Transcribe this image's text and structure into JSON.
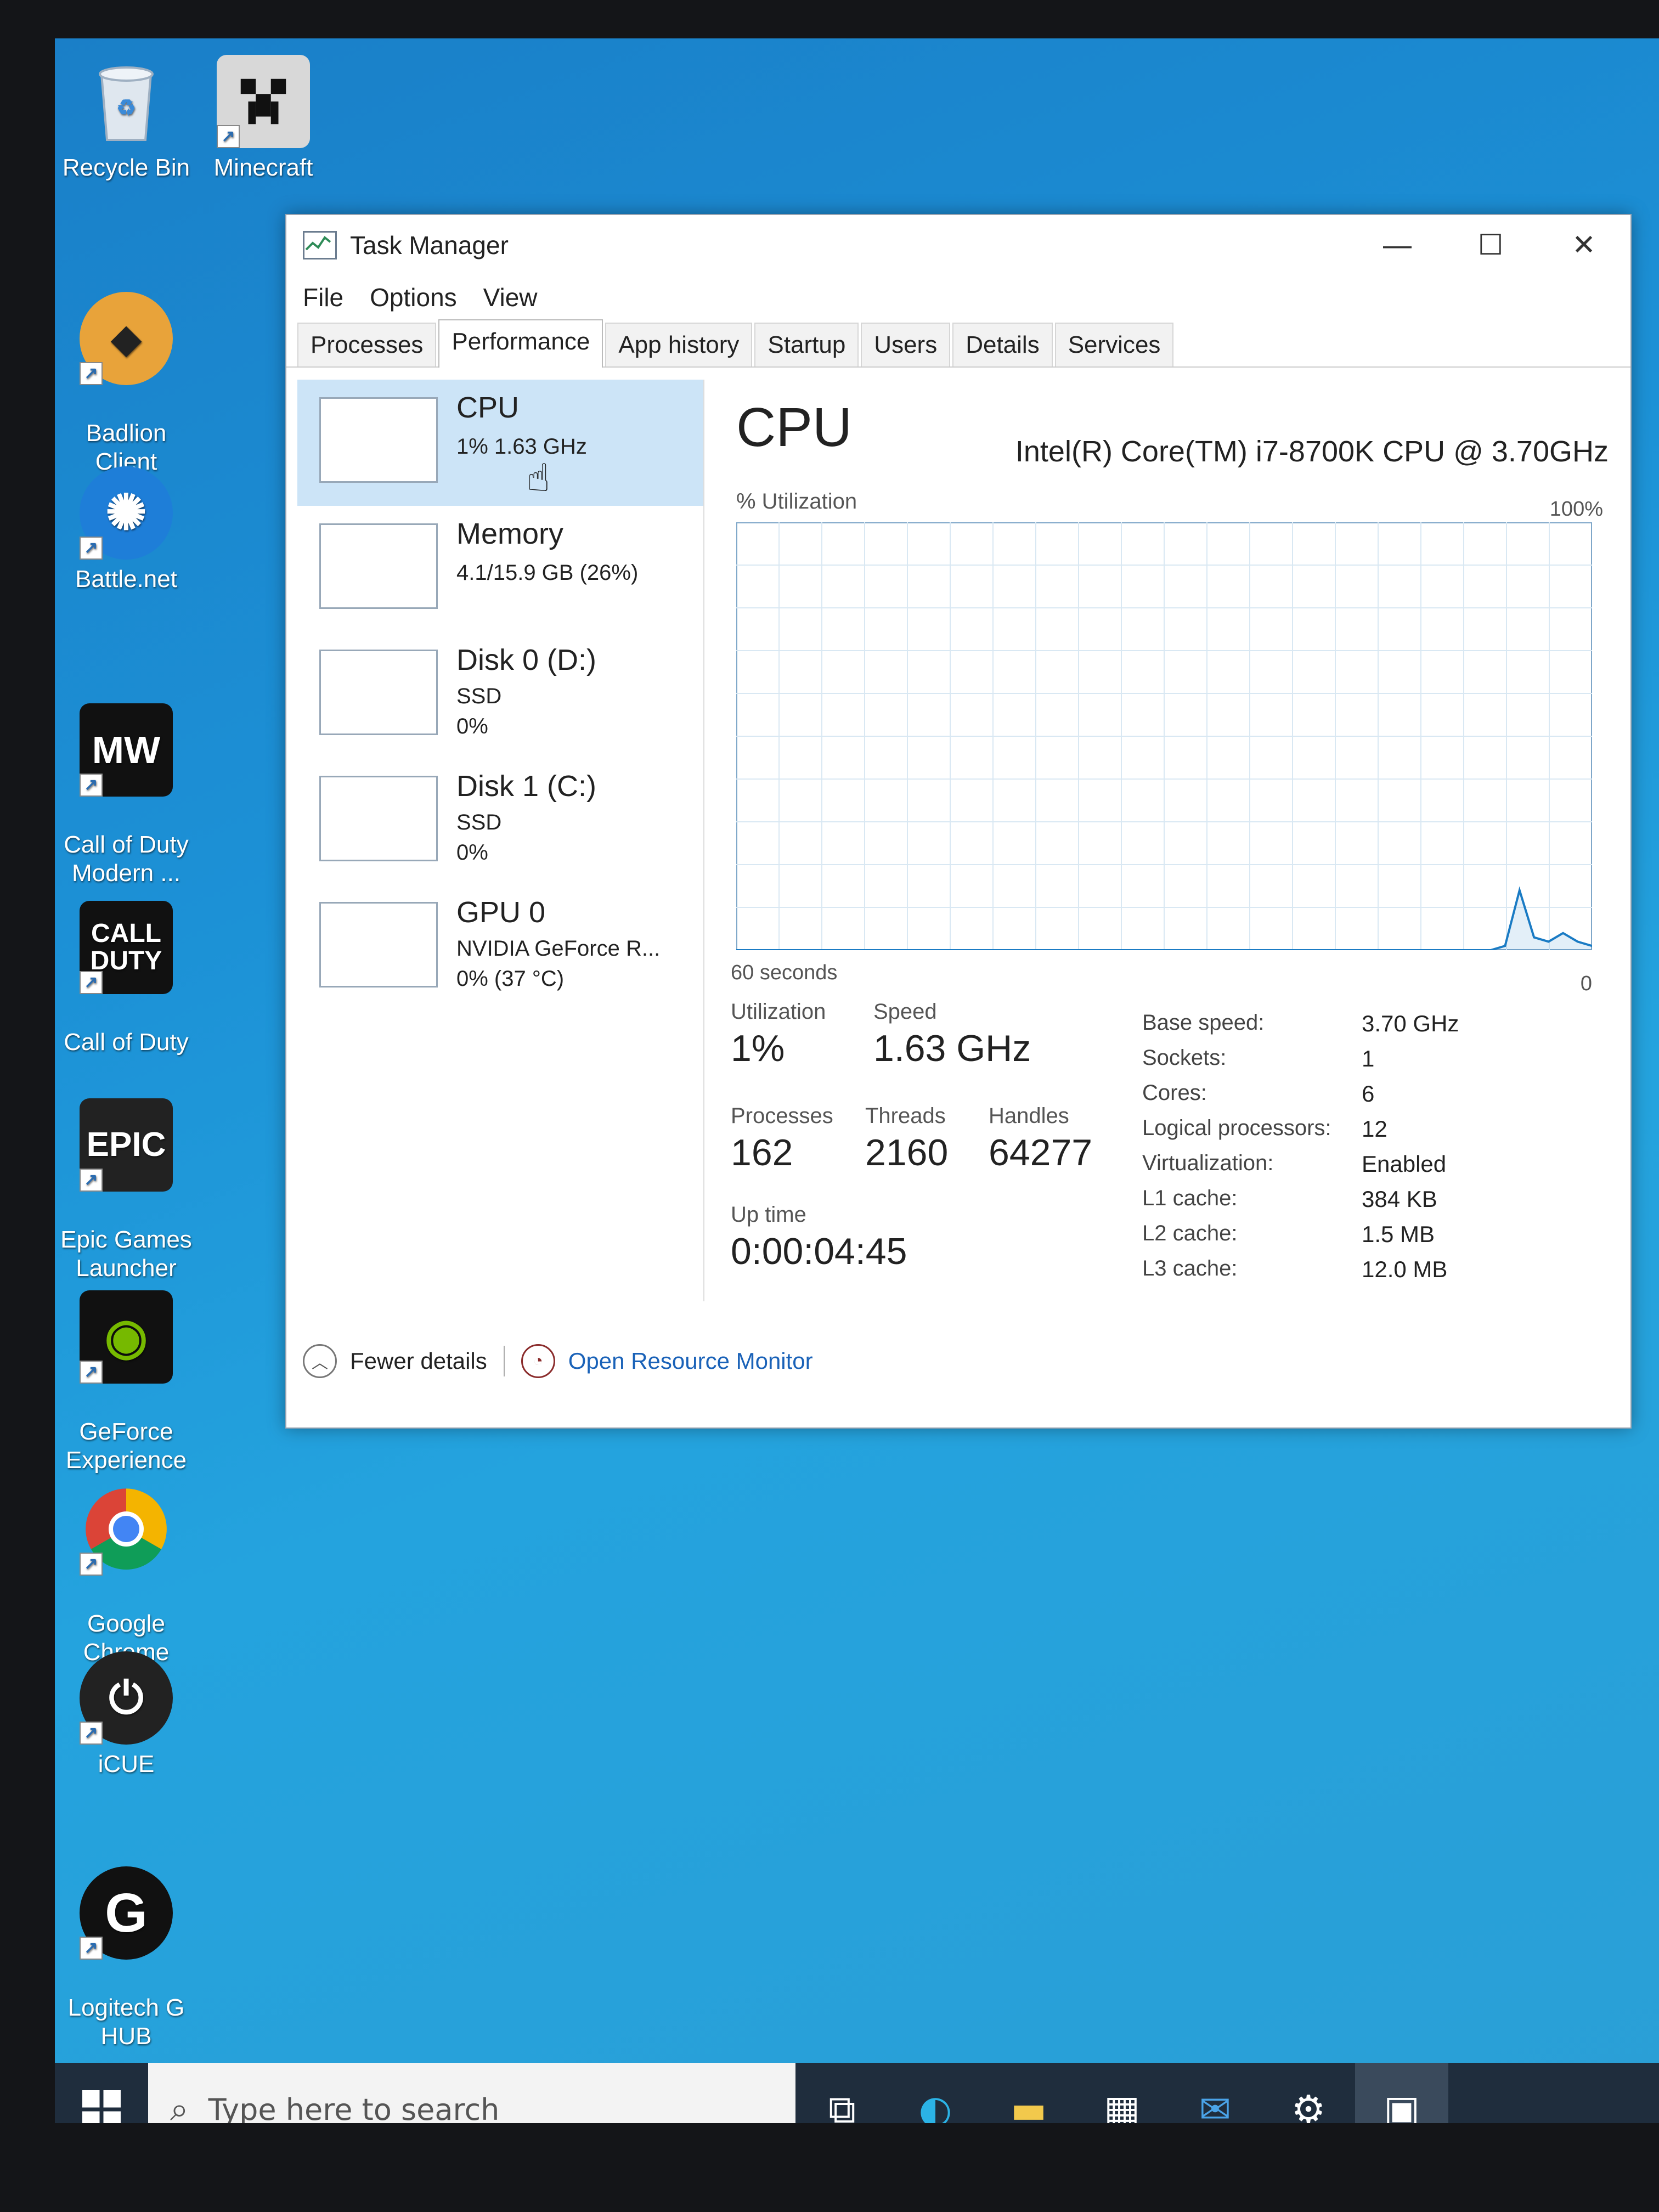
{
  "desktop": {
    "icons": [
      {
        "label": "Recycle Bin",
        "icon": "recycle-bin-icon"
      },
      {
        "label": "Minecraft",
        "icon": "minecraft-icon"
      },
      {
        "label": "Badlion\nClient",
        "icon": "badlion-icon"
      },
      {
        "label": "Battle.net",
        "icon": "battlenet-icon"
      },
      {
        "label": "Call of Duty\nModern ...",
        "icon": "mw-icon"
      },
      {
        "label": "Call of Duty",
        "icon": "cod-icon"
      },
      {
        "label": "Epic Games\nLauncher",
        "icon": "epic-icon"
      },
      {
        "label": "GeForce\nExperience",
        "icon": "nvidia-icon"
      },
      {
        "label": "Google\nChrome",
        "icon": "chrome-icon"
      },
      {
        "label": "iCUE",
        "icon": "icue-icon"
      },
      {
        "label": "Logitech G\nHUB",
        "icon": "logitech-icon"
      }
    ],
    "glyphs": {
      "mw": "MW",
      "cod": "CALL\nDUTY",
      "epic": "EPIC",
      "logi": "G"
    }
  },
  "window": {
    "title": "Task Manager",
    "menu": [
      "File",
      "Options",
      "View"
    ],
    "tabs": [
      "Processes",
      "Performance",
      "App history",
      "Startup",
      "Users",
      "Details",
      "Services"
    ],
    "active_tab": "Performance"
  },
  "resources": [
    {
      "name": "CPU",
      "line1": "1% 1.63 GHz",
      "line2": ""
    },
    {
      "name": "Memory",
      "line1": "4.1/15.9 GB (26%)",
      "line2": ""
    },
    {
      "name": "Disk 0 (D:)",
      "line1": "SSD",
      "line2": "0%"
    },
    {
      "name": "Disk 1 (C:)",
      "line1": "SSD",
      "line2": "0%"
    },
    {
      "name": "GPU 0",
      "line1": "NVIDIA GeForce R...",
      "line2": "0% (37 °C)"
    }
  ],
  "cpu": {
    "title": "CPU",
    "model": "Intel(R) Core(TM) i7-8700K CPU @ 3.70GHz",
    "util_label": "% Utilization",
    "max_label": "100%",
    "time_label": "60 seconds",
    "min_label": "0",
    "history": [
      0,
      0,
      0,
      0,
      0,
      0,
      0,
      0,
      0,
      0,
      0,
      0,
      0,
      0,
      0,
      0,
      0,
      0,
      0,
      0,
      0,
      0,
      0,
      0,
      0,
      0,
      0,
      0,
      0,
      0,
      0,
      0,
      0,
      0,
      0,
      0,
      0,
      0,
      0,
      0,
      0,
      0,
      0,
      0,
      0,
      0,
      0,
      0,
      0,
      0,
      0,
      0,
      0,
      1,
      14,
      3,
      2,
      4,
      2,
      1
    ],
    "stats": {
      "utilization_label": "Utilization",
      "utilization": "1%",
      "speed_label": "Speed",
      "speed": "1.63 GHz",
      "processes_label": "Processes",
      "processes": "162",
      "threads_label": "Threads",
      "threads": "2160",
      "handles_label": "Handles",
      "handles": "64277",
      "uptime_label": "Up time",
      "uptime": "0:00:04:45"
    },
    "specs": [
      {
        "label": "Base speed:",
        "value": "3.70 GHz"
      },
      {
        "label": "Sockets:",
        "value": "1"
      },
      {
        "label": "Cores:",
        "value": "6"
      },
      {
        "label": "Logical processors:",
        "value": "12"
      },
      {
        "label": "Virtualization:",
        "value": "Enabled"
      },
      {
        "label": "L1 cache:",
        "value": "384 KB"
      },
      {
        "label": "L2 cache:",
        "value": "1.5 MB"
      },
      {
        "label": "L3 cache:",
        "value": "12.0 MB"
      }
    ]
  },
  "footer": {
    "fewer": "Fewer details",
    "monitor": "Open Resource Monitor"
  },
  "taskbar": {
    "search_placeholder": "Type here to search"
  },
  "colors": {
    "accent": "#1a62b8",
    "selected": "#cce4f7",
    "graph_line": "#1a7bc4",
    "grid": "#d9e8f3"
  }
}
